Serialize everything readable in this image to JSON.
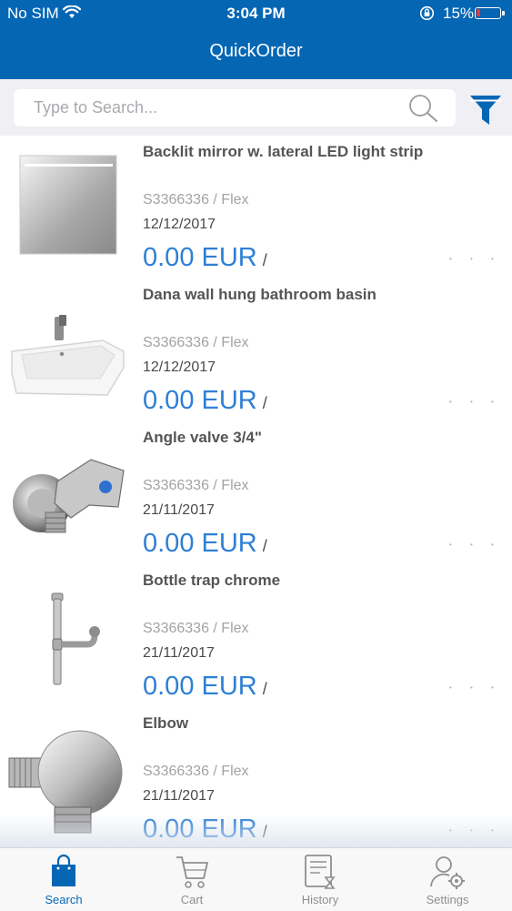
{
  "status_bar": {
    "carrier": "No SIM",
    "time": "3:04 PM",
    "battery_percent": "15%",
    "battery_color": "#e53935"
  },
  "header": {
    "title": "QuickOrder",
    "background": "#0566b4"
  },
  "search": {
    "placeholder": "Type to Search...",
    "icon": "search-icon",
    "filter_icon": "filter-icon"
  },
  "products": [
    {
      "name": "Backlit mirror w. lateral LED light strip",
      "sku": "S3366336 / Flex",
      "date": "12/12/2017",
      "price": "0.00 EUR",
      "unit": "/",
      "image": "mirror-image"
    },
    {
      "name": "Dana wall hung bathroom basin",
      "sku": "S3366336 / Flex",
      "date": "12/12/2017",
      "price": "0.00 EUR",
      "unit": "/",
      "image": "basin-image"
    },
    {
      "name": "Angle valve 3/4\"",
      "sku": "S3366336 / Flex",
      "date": "21/11/2017",
      "price": "0.00 EUR",
      "unit": "/",
      "image": "valve-image"
    },
    {
      "name": "Bottle trap chrome",
      "sku": "S3366336 / Flex",
      "date": "21/11/2017",
      "price": "0.00 EUR",
      "unit": "/",
      "image": "trap-image"
    },
    {
      "name": "Elbow",
      "sku": "S3366336 / Flex",
      "date": "21/11/2017",
      "price": "0.00 EUR",
      "unit": "/",
      "image": "elbow-image"
    }
  ],
  "more_glyph": "• • •",
  "tabs": [
    {
      "label": "Search",
      "icon": "shopping-bag-icon",
      "active": true
    },
    {
      "label": "Cart",
      "icon": "cart-icon",
      "active": false
    },
    {
      "label": "History",
      "icon": "history-icon",
      "active": false
    },
    {
      "label": "Settings",
      "icon": "settings-icon",
      "active": false
    }
  ],
  "colors": {
    "accent": "#0566b4",
    "price": "#2e7fd5",
    "inactive_tab": "#8e8e93"
  }
}
